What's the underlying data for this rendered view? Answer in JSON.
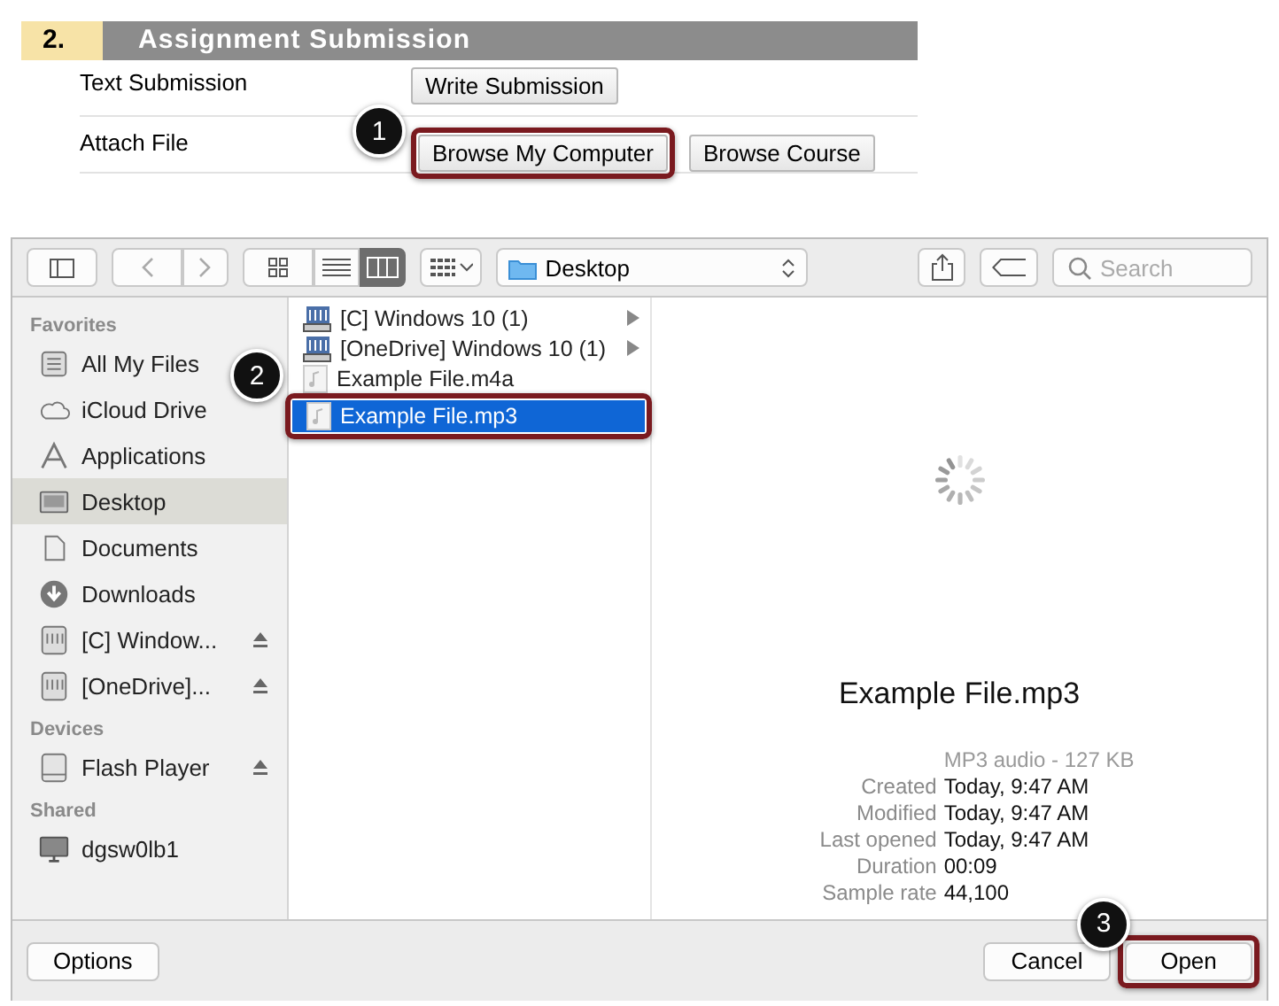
{
  "assignment": {
    "number": "2.",
    "title": "Assignment Submission",
    "rows": [
      {
        "label": "Text Submission",
        "buttons": [
          {
            "label": "Write Submission"
          }
        ]
      },
      {
        "label": "Attach File",
        "buttons": [
          {
            "label": "Browse My Computer",
            "callout": "1"
          },
          {
            "label": "Browse Course"
          }
        ]
      }
    ]
  },
  "dialog": {
    "toolbar": {
      "view_modes": [
        {
          "kind": "icons",
          "selected": false
        },
        {
          "kind": "list",
          "selected": false
        },
        {
          "kind": "columns",
          "selected": true
        }
      ],
      "location": "Desktop",
      "search": {
        "placeholder": "Search"
      }
    },
    "sidebar": [
      {
        "heading": "Favorites",
        "items": [
          {
            "label": "All My Files",
            "kind": "files",
            "selected": false,
            "eject": false
          },
          {
            "label": "iCloud Drive",
            "kind": "cloud",
            "selected": false,
            "eject": false
          },
          {
            "label": "Applications",
            "kind": "apps",
            "selected": false,
            "eject": false
          },
          {
            "label": "Desktop",
            "kind": "desktop",
            "selected": true,
            "eject": false
          },
          {
            "label": "Documents",
            "kind": "documents",
            "selected": false,
            "eject": false
          },
          {
            "label": "Downloads",
            "kind": "downloads",
            "selected": false,
            "eject": false
          },
          {
            "label": "[C] Window...",
            "kind": "drive",
            "selected": false,
            "eject": true
          },
          {
            "label": "[OneDrive]...",
            "kind": "drive",
            "selected": false,
            "eject": true
          }
        ]
      },
      {
        "heading": "Devices",
        "items": [
          {
            "label": "Flash Player",
            "kind": "disk",
            "selected": false,
            "eject": true
          }
        ]
      },
      {
        "heading": "Shared",
        "items": [
          {
            "label": "dgsw0lb1",
            "kind": "computer",
            "selected": false,
            "eject": false
          }
        ]
      }
    ],
    "files": [
      {
        "name": "[C] Windows 10 (1)",
        "kind": "share",
        "folder": true,
        "selected": false
      },
      {
        "name": "[OneDrive] Windows 10 (1)",
        "kind": "share",
        "folder": true,
        "selected": false
      },
      {
        "name": "Example File.m4a",
        "kind": "audio",
        "folder": false,
        "selected": false
      },
      {
        "name": "Example File.mp3",
        "kind": "audio",
        "folder": false,
        "selected": true,
        "callout": "2"
      }
    ],
    "preview": {
      "name": "Example File.mp3",
      "summary": "MP3 audio - 127 KB",
      "details": [
        {
          "label": "Created",
          "value": "Today, 9:47 AM"
        },
        {
          "label": "Modified",
          "value": "Today, 9:47 AM"
        },
        {
          "label": "Last opened",
          "value": "Today, 9:47 AM"
        },
        {
          "label": "Duration",
          "value": "00:09"
        },
        {
          "label": "Sample rate",
          "value": "44,100"
        }
      ]
    },
    "options_button": "Options",
    "actions": [
      {
        "label": "Cancel"
      },
      {
        "label": "Open",
        "callout": "3"
      }
    ]
  }
}
